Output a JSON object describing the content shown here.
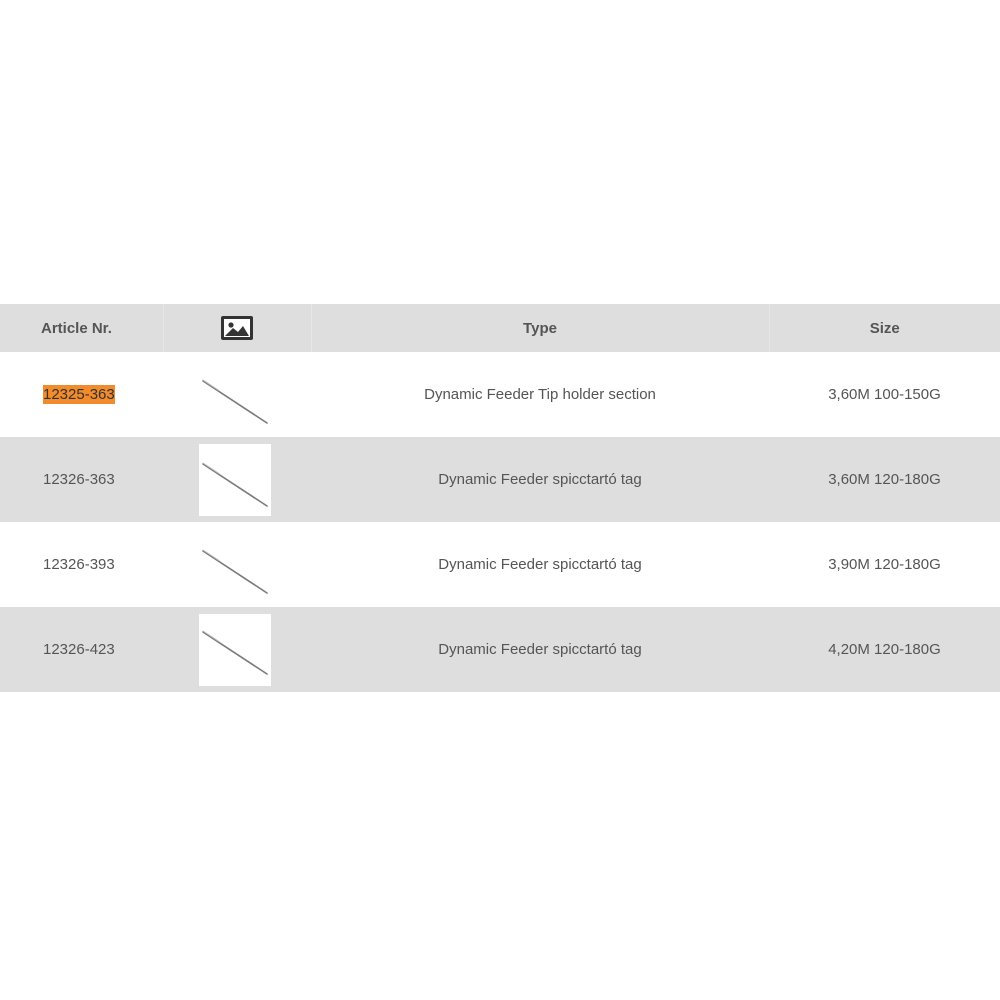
{
  "table": {
    "headers": {
      "article": "Article Nr.",
      "image_icon": "image-icon",
      "type": "Type",
      "size": "Size"
    },
    "rows": [
      {
        "article": "12325-363",
        "type": "Dynamic Feeder Tip holder section",
        "size": "3,60M 100-150G",
        "highlighted": true
      },
      {
        "article": "12326-363",
        "type": "Dynamic Feeder spicctartó tag",
        "size": "3,60M 120-180G",
        "highlighted": false
      },
      {
        "article": "12326-393",
        "type": "Dynamic Feeder spicctartó tag",
        "size": "3,90M 120-180G",
        "highlighted": false
      },
      {
        "article": "12326-423",
        "type": "Dynamic Feeder spicctartó tag",
        "size": "4,20M 120-180G",
        "highlighted": false
      }
    ]
  },
  "colors": {
    "header_bg": "#dedede",
    "stripe_bg": "#dedede",
    "highlight": "#f28b2b",
    "text": "#555555"
  }
}
